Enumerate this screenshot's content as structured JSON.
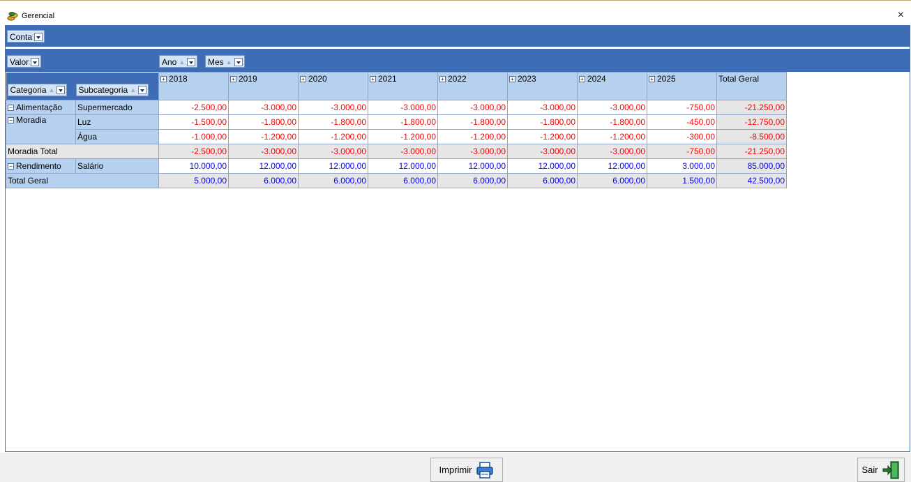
{
  "window": {
    "title": "Gerencial",
    "close_glyph": "×"
  },
  "filters": {
    "conta": "Conta",
    "valor": "Valor",
    "ano": "Ano",
    "mes": "Mes",
    "categoria": "Categoria",
    "subcategoria": "Subcategoria"
  },
  "columns": [
    "2018",
    "2019",
    "2020",
    "2021",
    "2022",
    "2023",
    "2024",
    "2025"
  ],
  "grand_total_col": "Total Geral",
  "rows": {
    "alimentacao": {
      "category": "Alimentação",
      "sub": "Supermercado",
      "values": [
        "-2.500,00",
        "-3.000,00",
        "-3.000,00",
        "-3.000,00",
        "-3.000,00",
        "-3.000,00",
        "-3.000,00",
        "-750,00"
      ],
      "total": "-21.250,00"
    },
    "moradia_luz": {
      "category": "Moradia",
      "sub": "Luz",
      "values": [
        "-1.500,00",
        "-1.800,00",
        "-1.800,00",
        "-1.800,00",
        "-1.800,00",
        "-1.800,00",
        "-1.800,00",
        "-450,00"
      ],
      "total": "-12.750,00"
    },
    "moradia_agua": {
      "sub": "Água",
      "values": [
        "-1.000,00",
        "-1.200,00",
        "-1.200,00",
        "-1.200,00",
        "-1.200,00",
        "-1.200,00",
        "-1.200,00",
        "-300,00"
      ],
      "total": "-8.500,00"
    },
    "moradia_total": {
      "label": "Moradia Total",
      "values": [
        "-2.500,00",
        "-3.000,00",
        "-3.000,00",
        "-3.000,00",
        "-3.000,00",
        "-3.000,00",
        "-3.000,00",
        "-750,00"
      ],
      "total": "-21.250,00"
    },
    "rendimento": {
      "category": "Rendimento",
      "sub": "Salário",
      "values": [
        "10.000,00",
        "12.000,00",
        "12.000,00",
        "12.000,00",
        "12.000,00",
        "12.000,00",
        "12.000,00",
        "3.000,00"
      ],
      "total": "85.000,00"
    },
    "total_geral": {
      "label": "Total Geral",
      "values": [
        "5.000,00",
        "6.000,00",
        "6.000,00",
        "6.000,00",
        "6.000,00",
        "6.000,00",
        "6.000,00",
        "1.500,00"
      ],
      "total": "42.500,00"
    }
  },
  "buttons": {
    "imprimir": "Imprimir",
    "sair": "Sair"
  },
  "icons": {
    "app": "coins-icon",
    "print": "printer-icon",
    "exit": "exit-door-icon"
  },
  "colors": {
    "band": "#3e6db5",
    "header": "#b6d1f0",
    "negative": "#ff0000",
    "positive": "#0000ff",
    "total_bg": "#e6e6e6"
  }
}
